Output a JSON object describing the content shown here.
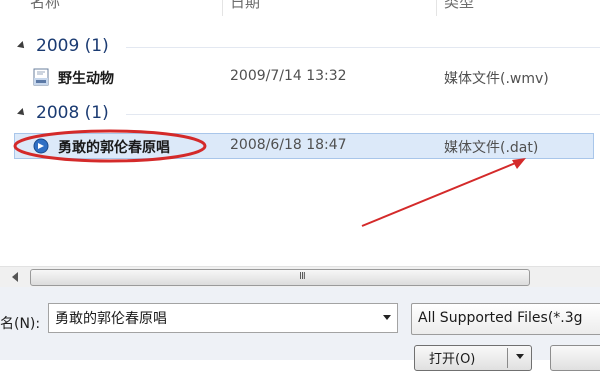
{
  "columns": {
    "name": "名称",
    "date": "日期",
    "type": "类型"
  },
  "groups": [
    {
      "label": "2009 (1)",
      "files": [
        {
          "name": "野生动物",
          "date": "2009/7/14 13:32",
          "type": "媒体文件(.wmv)",
          "icon": "wmv-file-icon",
          "selected": false
        }
      ]
    },
    {
      "label": "2008 (1)",
      "files": [
        {
          "name": "勇敢的郭伦春原唱",
          "date": "2008/6/18 18:47",
          "type": "媒体文件(.dat)",
          "icon": "media-file-icon",
          "selected": true
        }
      ]
    }
  ],
  "scrollbar": {
    "grip": "III"
  },
  "footer": {
    "filename_label": "名(N):",
    "filename_value": "勇敢的郭伦春原唱",
    "filter_label": "All Supported Files(*.3g",
    "open_label": "打开(O)"
  },
  "annotation_color": "#d42a2a",
  "selection_color": "#dce9f9",
  "group_label_color": "#1b3b72"
}
